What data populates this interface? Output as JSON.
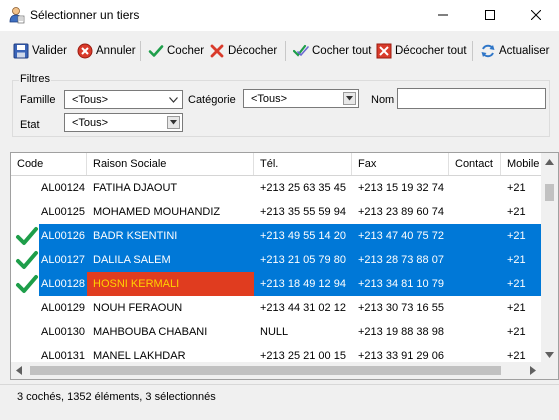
{
  "window": {
    "title": "Sélectionner un tiers"
  },
  "toolbar": {
    "valider": "Valider",
    "annuler": "Annuler",
    "cocher": "Cocher",
    "decocher": "Décocher",
    "cocher_tout": "Cocher tout",
    "decocher_tout": "Décocher tout",
    "actualiser": "Actualiser"
  },
  "filters": {
    "legend": "Filtres",
    "famille_label": "Famille",
    "famille_value": "<Tous>",
    "categorie_label": "Catégorie",
    "categorie_value": "<Tous>",
    "nom_label": "Nom",
    "nom_value": "",
    "etat_label": "Etat",
    "etat_value": "<Tous>"
  },
  "grid": {
    "columns": [
      "Code",
      "Raison Sociale",
      "Tél.",
      "Fax",
      "Contact",
      "Mobile"
    ],
    "rows": [
      {
        "checked": false,
        "selected": false,
        "code": "AL00124",
        "raison": "FATIHA DJAOUT",
        "tel": "+213 25 63 35 45",
        "fax": "+213 15 19 32 74",
        "contact": "",
        "mobile": "+21"
      },
      {
        "checked": false,
        "selected": false,
        "code": "AL00125",
        "raison": "MOHAMED MOUHANDIZ",
        "tel": "+213 35 55 59 94",
        "fax": "+213 23 89 60 74",
        "contact": "",
        "mobile": "+21"
      },
      {
        "checked": true,
        "selected": true,
        "code": "AL00126",
        "raison": "BADR KSENTINI",
        "tel": "+213 49 55 14 20",
        "fax": "+213 47 40 75 72",
        "contact": "",
        "mobile": "+21"
      },
      {
        "checked": true,
        "selected": true,
        "code": "AL00127",
        "raison": "DALILA SALEM",
        "tel": "+213 21 05 79 80",
        "fax": "+213 28 73 88 07",
        "contact": "",
        "mobile": "+21"
      },
      {
        "checked": true,
        "selected": true,
        "highlight": true,
        "code": "AL00128",
        "raison": "HOSNI KERMALI",
        "tel": "+213 18 49 12 94",
        "fax": "+213 34 81 10 79",
        "contact": "",
        "mobile": "+21"
      },
      {
        "checked": false,
        "selected": false,
        "code": "AL00129",
        "raison": "NOUH FERAOUN",
        "tel": "+213 44 31 02 12",
        "fax": "+213 30 73 16 55",
        "contact": "",
        "mobile": "+21"
      },
      {
        "checked": false,
        "selected": false,
        "code": "AL00130",
        "raison": "MAHBOUBA CHABANI",
        "tel": "NULL",
        "fax": "+213 19 88 38 98",
        "contact": "",
        "mobile": "+21"
      },
      {
        "checked": false,
        "selected": false,
        "code": "AL00131",
        "raison": "MANEL LAKHDAR",
        "tel": "+213 25 21 00 15",
        "fax": "+213 33 91 29 06",
        "contact": "",
        "mobile": "+21"
      }
    ]
  },
  "status": {
    "text": "3 cochés, 1352 éléments, 3 sélectionnés"
  },
  "colors": {
    "selection": "#0078d7",
    "highlight_bg": "#e03c1f",
    "highlight_fg": "#ffd200",
    "check": "#1e9e4a"
  }
}
